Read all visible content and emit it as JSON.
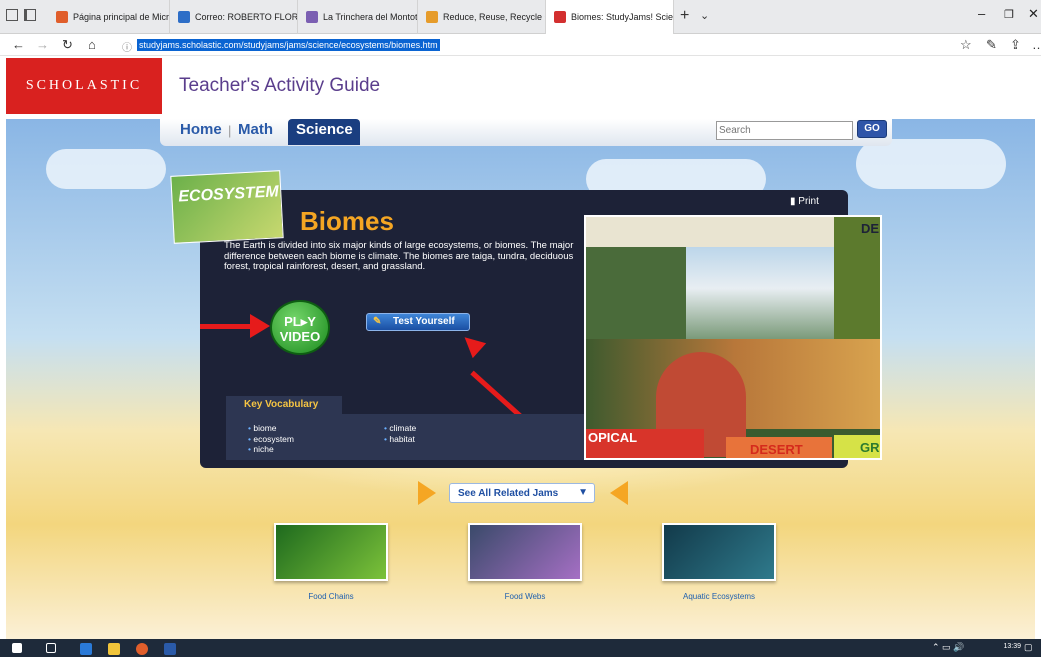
{
  "browser": {
    "tabs": [
      {
        "label": "Página principal de Microso",
        "favicon_color": "#e05e2b"
      },
      {
        "label": "Correo: ROBERTO FLOREZ P",
        "favicon_color": "#2d6ec7"
      },
      {
        "label": "La Trinchera del Montoto - (",
        "favicon_color": "#7b5fb2"
      },
      {
        "label": "Reduce, Reuse, Recycle Gam",
        "favicon_color": "#e69c2b"
      },
      {
        "label": "Biomes: StudyJams! Scie",
        "favicon_color": "#d32f2f"
      }
    ],
    "active_tab_index": 4,
    "new_tab_label": "+",
    "url": "studyjams.scholastic.com/studyjams/jams/science/ecosystems/biomes.htm"
  },
  "site": {
    "brand": "SCHOLASTIC",
    "header_title": "Teacher's Activity Guide",
    "nav": {
      "home": "Home",
      "math": "Math",
      "science": "Science"
    },
    "search_placeholder": "Search",
    "go_label": "GO"
  },
  "lesson": {
    "badge": "ECOSYSTEM",
    "title": "Biomes",
    "print_label": "Print",
    "intro": "The Earth is divided into six major kinds of large ecosystems, or biomes. The major difference between each biome is climate. The biomes are taiga, tundra, deciduous forest, tropical rainforest, desert, and grassland.",
    "play_top": "PL▸Y",
    "play_bottom": "VIDEO",
    "test_label": "Test Yourself",
    "vocab_title": "Key Vocabulary",
    "vocab_col1": [
      "biome",
      "ecosystem",
      "niche"
    ],
    "vocab_col2": [
      "climate",
      "habitat"
    ],
    "collage_labels": {
      "top_right": "DE",
      "bottom_left": "OPICAL",
      "bottom_mid": "DESERT",
      "bottom_right": "GR"
    }
  },
  "related": {
    "button_label": "See All Related Jams",
    "items": [
      {
        "label": "Food Chains"
      },
      {
        "label": "Food Webs"
      },
      {
        "label": "Aquatic Ecosystems"
      }
    ]
  },
  "taskbar": {
    "time": "13:39"
  },
  "colors": {
    "brand_red": "#d9211f",
    "accent_orange": "#f5a623",
    "nav_blue": "#1a3e80"
  }
}
